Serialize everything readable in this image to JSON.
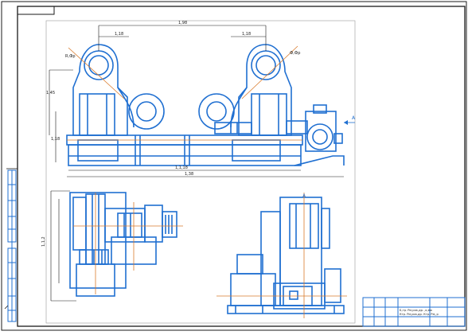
{
  "drawing": {
    "line_color": "#1f6fd1",
    "frame_color": "#1a1a1a",
    "dim_color": "#1a1a1a",
    "accent_color": "#d97a2b",
    "view_label": "A",
    "view_label_section": "A",
    "dim_top": "1,98",
    "dim_left_gap": "1,18",
    "dim_right_gap": "1,18",
    "dim_radius_left": "R,Фр",
    "dim_radius_right": "Ф,Фр",
    "dim_height_upper": "1,45",
    "dim_height_lower": "1,18",
    "dim_span_inner": "1,1,18",
    "dim_span_outer": "1,38",
    "dim_plan_height": "1,1,2",
    "title_block": {
      "row1": "Б,тр. Рм,рок,др. ,о,еж",
      "row2": "Ктр. Рм,рок,др. Ктр. Рм,,р"
    }
  }
}
